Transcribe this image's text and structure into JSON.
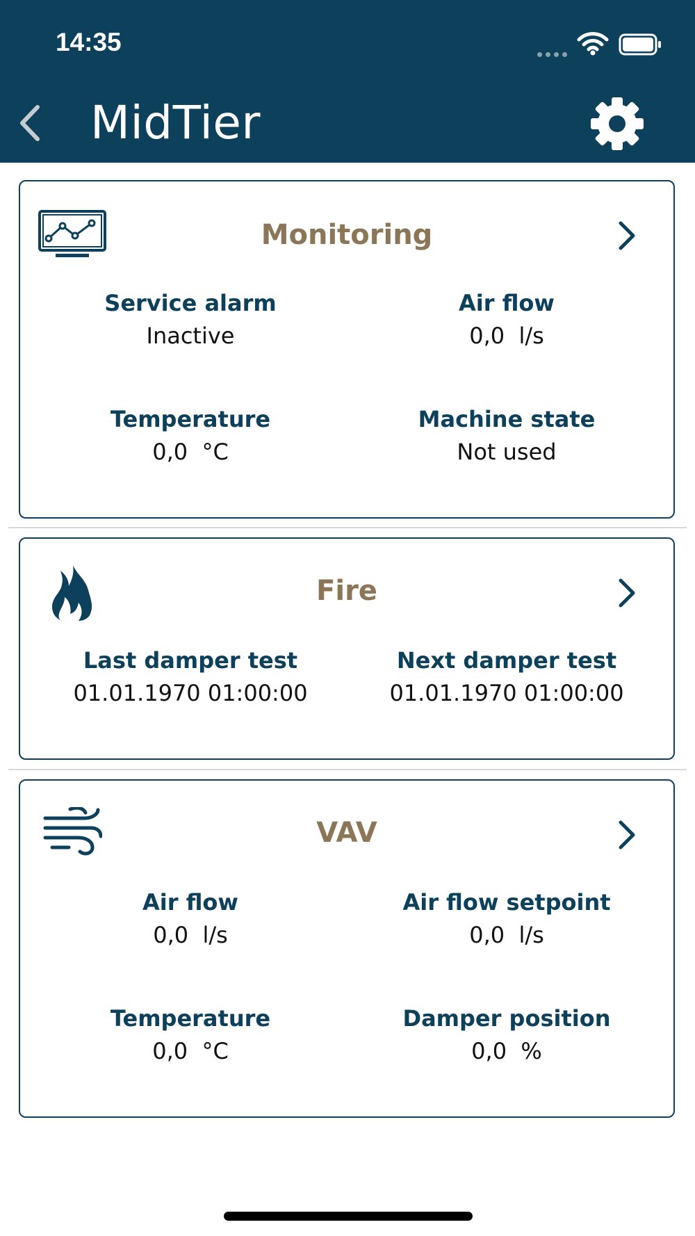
{
  "status_bar": {
    "time": "14:35"
  },
  "header": {
    "title": "MidTier"
  },
  "cards": {
    "monitoring": {
      "title": "Monitoring",
      "items": [
        {
          "label": "Service alarm",
          "value": "Inactive"
        },
        {
          "label": "Air flow",
          "value": "0,0  l/s"
        },
        {
          "label": "Temperature",
          "value": "0,0  °C"
        },
        {
          "label": "Machine state",
          "value": "Not used"
        }
      ]
    },
    "fire": {
      "title": "Fire",
      "items": [
        {
          "label": "Last damper test",
          "value": "01.01.1970 01:00:00"
        },
        {
          "label": "Next damper test",
          "value": "01.01.1970 01:00:00"
        }
      ]
    },
    "vav": {
      "title": "VAV",
      "items": [
        {
          "label": "Air flow",
          "value": "0,0  l/s"
        },
        {
          "label": "Air flow setpoint",
          "value": "0,0  l/s"
        },
        {
          "label": "Temperature",
          "value": "0,0  °C"
        },
        {
          "label": "Damper position",
          "value": "0,0  %"
        }
      ]
    }
  },
  "colors": {
    "header_bg": "#0d405a",
    "primary": "#0d405a",
    "card_title": "#8b7757"
  },
  "icons": {
    "back": "chevron-left-icon",
    "settings": "gear-icon",
    "monitoring": "monitor-chart-icon",
    "fire": "flame-icon",
    "vav": "wind-icon",
    "open": "chevron-right-icon"
  }
}
